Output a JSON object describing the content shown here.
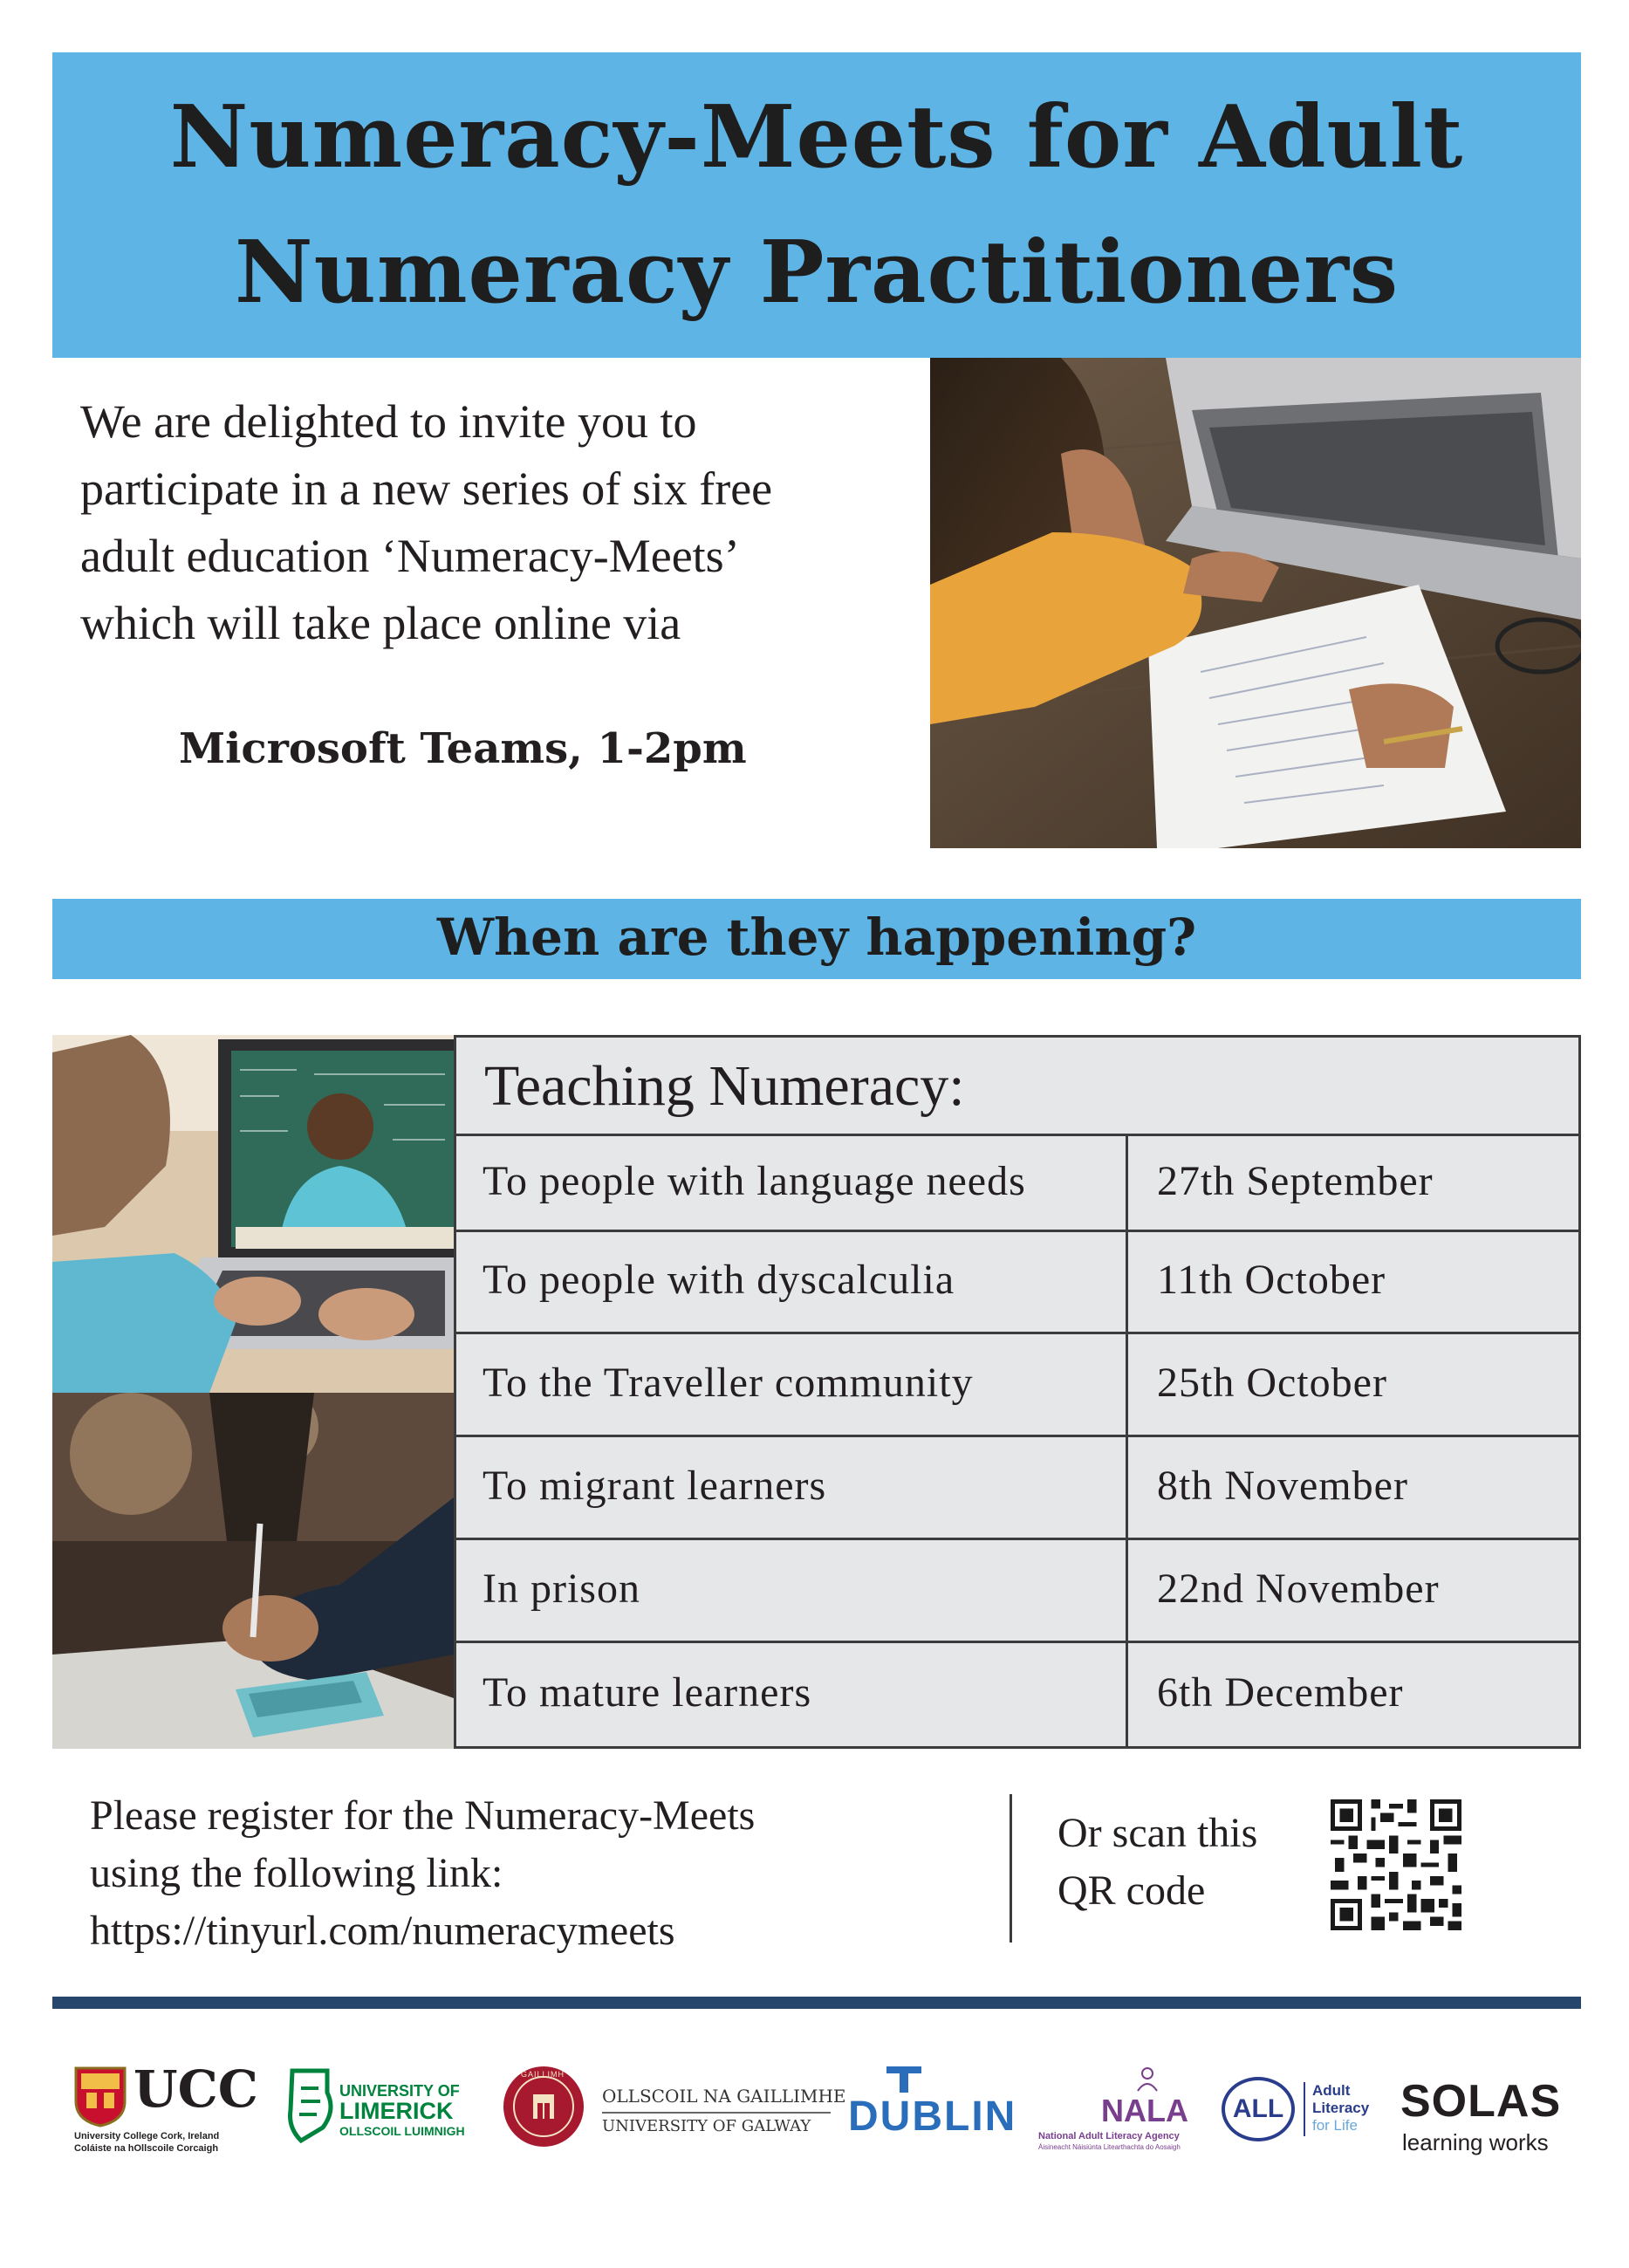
{
  "title": {
    "line1": "Numeracy-Meets for Adult",
    "line2": "Numeracy Practitioners"
  },
  "intro": {
    "lines": [
      "We are delighted to invite you to",
      "participate in a new series of six free",
      "adult education ‘Numeracy-Meets’",
      "which will take place online via"
    ],
    "platform": "Microsoft Teams, 1-2pm"
  },
  "when_heading": "When are they happening?",
  "schedule": {
    "heading": "Teaching Numeracy:",
    "rows": [
      {
        "topic": "To people with language needs",
        "date": "27th September"
      },
      {
        "topic": "To people with dyscalculia",
        "date": "11th October"
      },
      {
        "topic": "To the Traveller community",
        "date": "25th October"
      },
      {
        "topic": "To migrant learners",
        "date": "8th November"
      },
      {
        "topic": "In prison",
        "date": "22nd November"
      },
      {
        "topic": "To mature learners",
        "date": "6th December"
      }
    ]
  },
  "register": {
    "lines": [
      "Please register for the Numeracy-Meets",
      "using the following link:",
      "https://tinyurl.com/numeracymeets"
    ],
    "scan_lines": [
      "Or scan this",
      "QR code"
    ]
  },
  "logos": {
    "ucc": {
      "name": "UCC",
      "sub1": "University College Cork, Ireland",
      "sub2": "Coláiste na hOllscoile Corcaigh"
    },
    "ul": {
      "line1": "UNIVERSITY OF",
      "line2": "LIMERICK",
      "line3": "OLLSCOIL LUIMNIGH"
    },
    "galway_seal": "GAILLIMH",
    "galway": {
      "line1": "OLLSCOIL NA GAILLIMHE",
      "line2": "UNIVERSITY OF GALWAY"
    },
    "tud": {
      "name": "DUBLIN"
    },
    "nala": {
      "name": "NALA",
      "sub1": "National Adult Literacy Agency",
      "sub2": "Áisineacht Náisiúnta Litearthachta do Aosaigh"
    },
    "all": {
      "badge": "ALL",
      "line1": "Adult",
      "line2": "Literacy",
      "line3": "for Life"
    },
    "solas": {
      "name": "SOLAS",
      "tagline": "learning works"
    }
  },
  "colors": {
    "banner_blue": "#5db4e5",
    "table_grey": "#e6e7e9",
    "footer_rule": "#26476b",
    "ul_green": "#00843d",
    "nala_purple": "#7a3e8e",
    "all_blue": "#2a3c8c"
  }
}
